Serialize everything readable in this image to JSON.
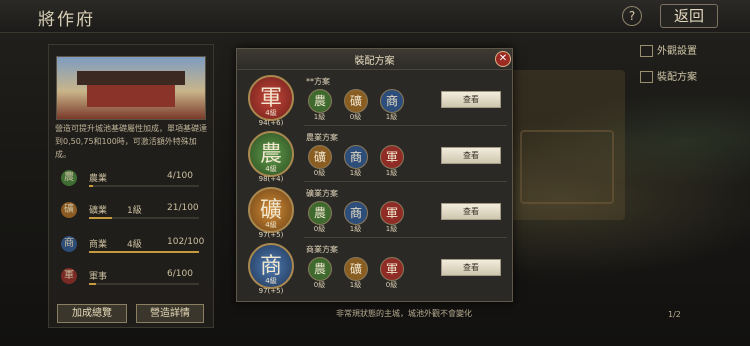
{
  "header": {
    "title": "將作府",
    "help": "?",
    "back": "返回"
  },
  "right_links": [
    {
      "label": "外觀設置",
      "icon": "building-icon"
    },
    {
      "label": "裝配方案",
      "icon": "scroll-icon"
    }
  ],
  "left_panel": {
    "description": "營造可提升城池基礎屬性加成，單項基礎達到0,50,75和100時，可激活額外特殊加成。",
    "stats": [
      {
        "icon_char": "農",
        "name": "農業",
        "level": "",
        "value": "4/100",
        "color": "#3f6e34",
        "progress": 0.04
      },
      {
        "icon_char": "礦",
        "name": "礦業",
        "level": "1級",
        "value": "21/100",
        "color": "#8a5a22",
        "progress": 0.21
      },
      {
        "icon_char": "商",
        "name": "商業",
        "level": "4級",
        "value": "102/100",
        "color": "#2d4d78",
        "progress": 1.0
      },
      {
        "icon_char": "軍",
        "name": "軍事",
        "level": "",
        "value": "6/100",
        "color": "#7a2a24",
        "progress": 0.06
      }
    ],
    "buttons": {
      "bonus": "加成總覽",
      "detail": "營造詳情"
    }
  },
  "dialog": {
    "title": "裝配方案",
    "close": "✕",
    "view_label": "查看",
    "schemes": [
      {
        "name": "**方案",
        "main_char": "軍",
        "main_level": "4級",
        "main_value": "94(+6)",
        "color": "#9a2e26",
        "slots": [
          {
            "char": "農",
            "level": "1級",
            "color": "#3e6a30"
          },
          {
            "char": "礦",
            "level": "0級",
            "color": "#8a5d23"
          },
          {
            "char": "商",
            "level": "1級",
            "color": "#2d4d7a"
          }
        ]
      },
      {
        "name": "農業方案",
        "main_char": "農",
        "main_level": "4級",
        "main_value": "98(+4)",
        "color": "#3f6e32",
        "slots": [
          {
            "char": "礦",
            "level": "0級",
            "color": "#8a5d23"
          },
          {
            "char": "商",
            "level": "1級",
            "color": "#2d4d7a"
          },
          {
            "char": "軍",
            "level": "1級",
            "color": "#8e2c25"
          }
        ]
      },
      {
        "name": "礦業方案",
        "main_char": "礦",
        "main_level": "4級",
        "main_value": "97(+5)",
        "color": "#9a6724",
        "slots": [
          {
            "char": "農",
            "level": "0級",
            "color": "#3e6a30"
          },
          {
            "char": "商",
            "level": "1級",
            "color": "#2d4d7a"
          },
          {
            "char": "軍",
            "level": "1級",
            "color": "#8e2c25"
          }
        ]
      },
      {
        "name": "商業方案",
        "main_char": "商",
        "main_level": "4級",
        "main_value": "97(+5)",
        "color": "#2c4d7c",
        "slots": [
          {
            "char": "農",
            "level": "0級",
            "color": "#3e6a30"
          },
          {
            "char": "礦",
            "level": "1級",
            "color": "#8a5d23"
          },
          {
            "char": "軍",
            "level": "0級",
            "color": "#8e2c25"
          }
        ]
      }
    ]
  },
  "footer": {
    "note": "非常規狀態的主城，城池外觀不會變化",
    "pager": "1/2"
  }
}
